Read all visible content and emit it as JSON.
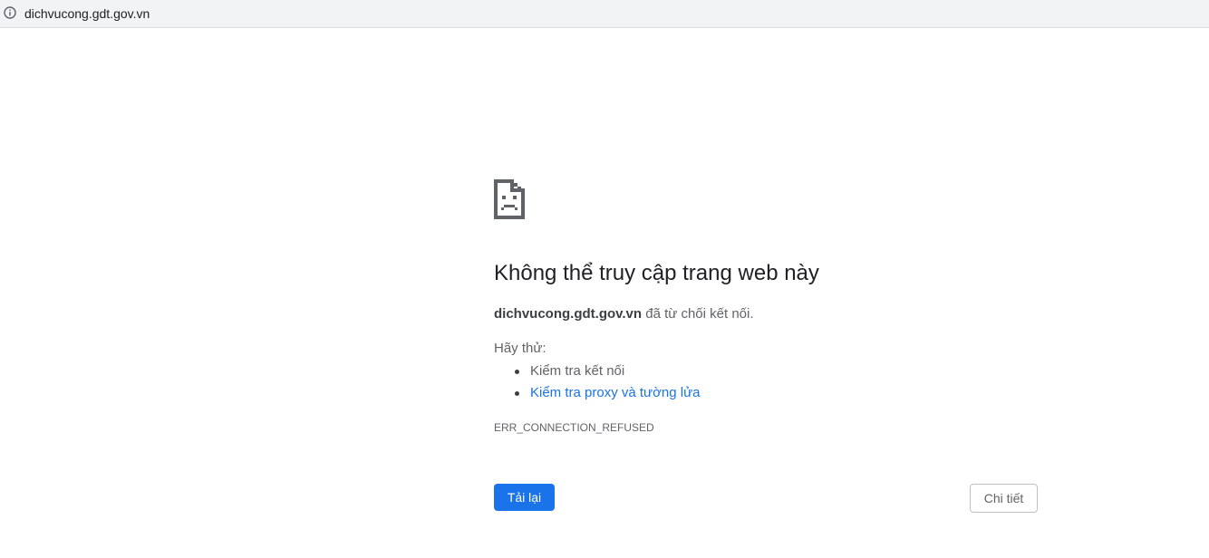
{
  "address_bar": {
    "url": "dichvucong.gdt.gov.vn",
    "icon": "info-icon"
  },
  "error_page": {
    "icon": "sad-page-icon",
    "heading": "Không thể truy cập trang web này",
    "host": "dichvucong.gdt.gov.vn",
    "summary_suffix": " đã từ chối kết nối.",
    "try_label": "Hãy thử:",
    "suggestions": [
      {
        "text": "Kiểm tra kết nối",
        "is_link": false
      },
      {
        "text": "Kiểm tra proxy và tường lửa",
        "is_link": true
      }
    ],
    "error_code": "ERR_CONNECTION_REFUSED",
    "reload_label": "Tải lại",
    "details_label": "Chi tiết"
  },
  "colors": {
    "accent": "#1a73e8",
    "text_primary": "#202124",
    "text_secondary": "#5f6368",
    "address_bar_bg": "#f1f3f4"
  }
}
